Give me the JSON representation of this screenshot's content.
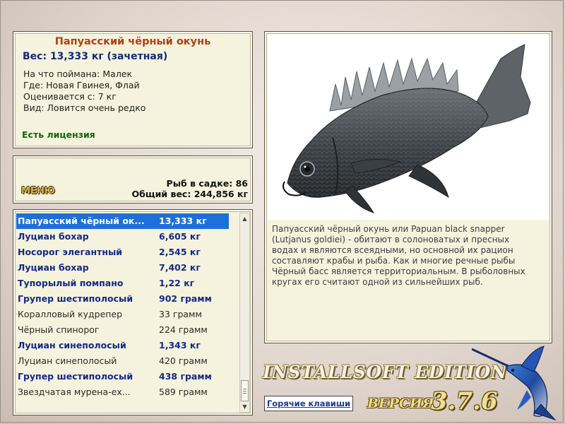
{
  "info": {
    "fish_name": "Папуасский чёрный окунь",
    "weight": "Вес: 13,333 кг (зачетная)",
    "caught_on": "На что поймана: Малек",
    "location": "Где: Новая Гвинея, Флай",
    "valued_from": "Оценивается с: 7 кг",
    "rarity": "Вид: Ловится очень редко",
    "license": "Есть лицензия"
  },
  "menu": {
    "label": "МЕНЮ",
    "fish_in_keepnet": "Рыб в садке: 86",
    "total_weight": "Общий вес: 244,856 кг"
  },
  "catch_list": [
    {
      "name": "Папуасский чёрный ок...",
      "weight": "13,333 кг",
      "style": "selected"
    },
    {
      "name": "Луциан бохар",
      "weight": "6,605 кг",
      "style": "rare"
    },
    {
      "name": "Носорог элегантный",
      "weight": "2,545 кг",
      "style": "rare"
    },
    {
      "name": "Луциан бохар",
      "weight": "7,402 кг",
      "style": "rare"
    },
    {
      "name": "Тупорылый помпано",
      "weight": "1,22 кг",
      "style": "rare"
    },
    {
      "name": "Групер шестиполосый",
      "weight": "902 грамм",
      "style": "rare"
    },
    {
      "name": "Коралловый кудрепер",
      "weight": "33 грамм",
      "style": "common"
    },
    {
      "name": "Чёрный спинорог",
      "weight": "224 грамм",
      "style": "common"
    },
    {
      "name": "Луциан синеполосый",
      "weight": "1,343 кг",
      "style": "rare"
    },
    {
      "name": "Луциан синеполосый",
      "weight": "420 грамм",
      "style": "common"
    },
    {
      "name": "Групер шестиполосый",
      "weight": "438 грамм",
      "style": "rare"
    },
    {
      "name": "Звездчатая мурена-ех...",
      "weight": "589 грамм",
      "style": "common"
    }
  ],
  "scrollbar": {
    "up_icon": "scroll-up-arrow",
    "down_icon": "scroll-down-arrow"
  },
  "description": "Папуасский чёрный окунь или Papuan black snapper (Lutjanus goldiei) - обитают в солоноватых и пресных водах и являются всеядными, но основной их рацион составляют крабы и рыба. Как и многие речные рыбы Чёрный басс является территориальным. В рыболовных кругах его считают одной из сильнейших рыб.",
  "footer": {
    "hotkeys": "Горячие клавиши",
    "edition": "INSTALLSOFT EDITION",
    "version_label": "ВЕРСИЯ",
    "version": "3.7.6"
  },
  "colors": {
    "panel_bg": "#f5f3dd",
    "title": "#b43e12",
    "weight": "#132b78",
    "license": "#0d6a0d",
    "rare": "#14298a",
    "selected": "#1e6fd9"
  }
}
